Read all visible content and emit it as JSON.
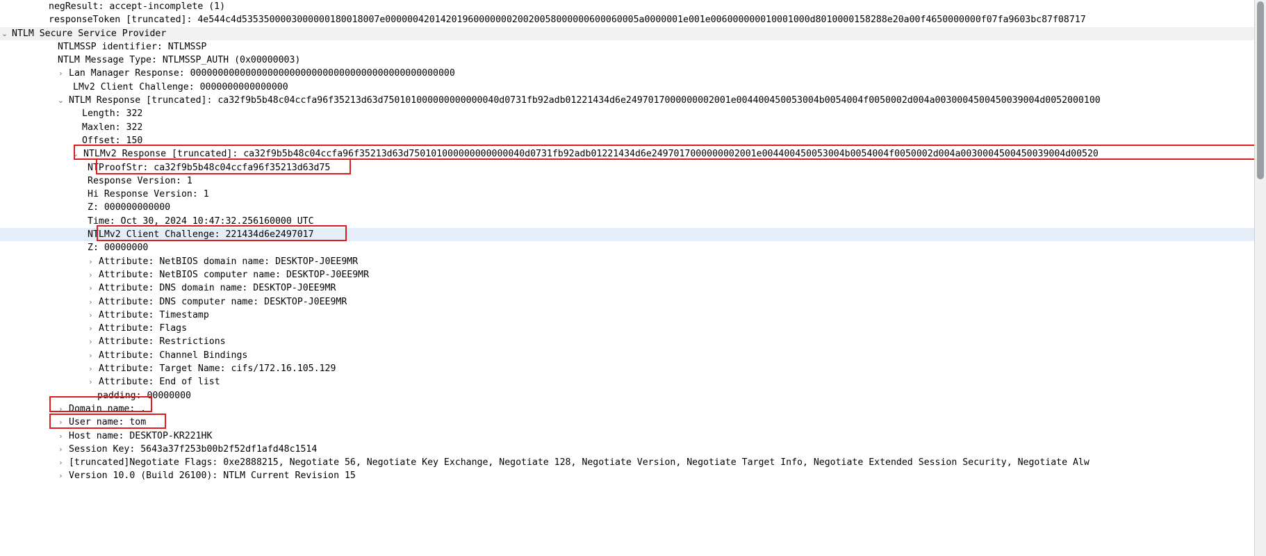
{
  "app": {
    "pane": "packet-detail-tree"
  },
  "colors": {
    "annotation": "#e01b1b",
    "selected_row": "#e4eef8",
    "shaded_row": "#f1f1f1",
    "text": "#000000",
    "twisty": "#6d6d6d",
    "scrollbar_track": "#f0f0f0",
    "scrollbar_thumb": "#9a9ea4"
  },
  "icons": {
    "expanded": "⌄",
    "collapsed": "›"
  },
  "rows": [
    {
      "text": "negResult: accept-incomplete (1)"
    },
    {
      "text": "responseToken [truncated]: 4e544c4d5353500003000000180018007e0000004201420196000000020020058000000600060005a0000001e001e006000000010001000d8010000158288e20a00f4650000000f07fa9603bc87f08717"
    },
    {
      "text": "NTLM Secure Service Provider"
    },
    {
      "text": "NTLMSSP identifier: NTLMSSP"
    },
    {
      "text": "NTLM Message Type: NTLMSSP_AUTH (0x00000003)"
    },
    {
      "text": "Lan Manager Response: 000000000000000000000000000000000000000000000000"
    },
    {
      "text": "LMv2 Client Challenge: 0000000000000000"
    },
    {
      "text": "NTLM Response [truncated]: ca32f9b5b48c04ccfa96f35213d63d750101000000000000040d0731fb92adb01221434d6e2497017000000002001e004400450053004b0054004f0050002d004a0030004500450039004d0052000100"
    },
    {
      "text": "Length: 322"
    },
    {
      "text": "Maxlen: 322"
    },
    {
      "text": "Offset: 150"
    },
    {
      "text": "NTLMv2 Response [truncated]: ca32f9b5b48c04ccfa96f35213d63d750101000000000000040d0731fb92adb01221434d6e2497017000000002001e004400450053004b0054004f0050002d004a0030004500450039004d00520"
    },
    {
      "text": "NTProofStr: ca32f9b5b48c04ccfa96f35213d63d75"
    },
    {
      "text": "Response Version: 1"
    },
    {
      "text": "Hi Response Version: 1"
    },
    {
      "text": "Z: 000000000000"
    },
    {
      "text": "Time: Oct 30, 2024 10:47:32.256160000 UTC"
    },
    {
      "text": "NTLMv2 Client Challenge: 221434d6e2497017"
    },
    {
      "text": "Z: 00000000"
    },
    {
      "text": "Attribute: NetBIOS domain name: DESKTOP-J0EE9MR"
    },
    {
      "text": "Attribute: NetBIOS computer name: DESKTOP-J0EE9MR"
    },
    {
      "text": "Attribute: DNS domain name: DESKTOP-J0EE9MR"
    },
    {
      "text": "Attribute: DNS computer name: DESKTOP-J0EE9MR"
    },
    {
      "text": "Attribute: Timestamp"
    },
    {
      "text": "Attribute: Flags"
    },
    {
      "text": "Attribute: Restrictions"
    },
    {
      "text": "Attribute: Channel Bindings"
    },
    {
      "text": "Attribute: Target Name: cifs/172.16.105.129"
    },
    {
      "text": "Attribute: End of list"
    },
    {
      "text": "padding: 00000000"
    },
    {
      "text": "Domain name: ."
    },
    {
      "text": "User name: tom"
    },
    {
      "text": "Host name: DESKTOP-KR221HK"
    },
    {
      "text": "Session Key: 5643a37f253b00b2f52df1afd48c1514"
    },
    {
      "text": "[truncated]Negotiate Flags: 0xe2888215, Negotiate 56, Negotiate Key Exchange, Negotiate 128, Negotiate Version, Negotiate Target Info, Negotiate Extended Session Security, Negotiate Alw"
    },
    {
      "text": "Version 10.0 (Build 26100): NTLM Current Revision 15"
    }
  ]
}
